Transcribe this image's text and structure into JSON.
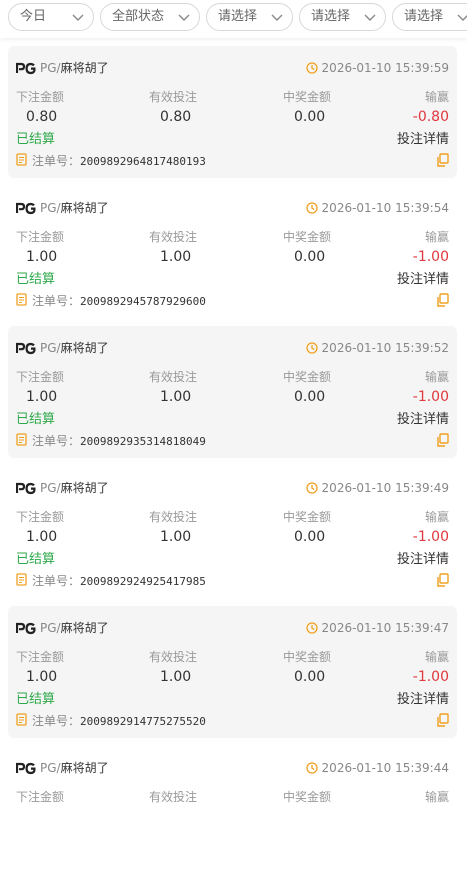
{
  "filters": [
    {
      "label": "今日"
    },
    {
      "label": "全部状态"
    },
    {
      "label": "请选择"
    },
    {
      "label": "请选择"
    },
    {
      "label": "请选择"
    }
  ],
  "columns": {
    "bet": "下注金额",
    "valid": "有效投注",
    "win": "中奖金额",
    "pnl": "输赢"
  },
  "labels": {
    "settled": "已结算",
    "detail": "投注详情",
    "order_prefix": "注单号："
  },
  "colors": {
    "accent": "#f0a020",
    "settled": "#2ea84a",
    "loss": "#e0383e"
  },
  "records": [
    {
      "provider": "PG/",
      "game": "麻将胡了",
      "time": "2026-01-10 15:39:59",
      "bet": "0.80",
      "valid": "0.80",
      "win": "0.00",
      "pnl": "-0.80",
      "status": "已结算",
      "order": "2009892964817480193"
    },
    {
      "provider": "PG/",
      "game": "麻将胡了",
      "time": "2026-01-10 15:39:54",
      "bet": "1.00",
      "valid": "1.00",
      "win": "0.00",
      "pnl": "-1.00",
      "status": "已结算",
      "order": "2009892945787929600"
    },
    {
      "provider": "PG/",
      "game": "麻将胡了",
      "time": "2026-01-10 15:39:52",
      "bet": "1.00",
      "valid": "1.00",
      "win": "0.00",
      "pnl": "-1.00",
      "status": "已结算",
      "order": "2009892935314818049"
    },
    {
      "provider": "PG/",
      "game": "麻将胡了",
      "time": "2026-01-10 15:39:49",
      "bet": "1.00",
      "valid": "1.00",
      "win": "0.00",
      "pnl": "-1.00",
      "status": "已结算",
      "order": "2009892924925417985"
    },
    {
      "provider": "PG/",
      "game": "麻将胡了",
      "time": "2026-01-10 15:39:47",
      "bet": "1.00",
      "valid": "1.00",
      "win": "0.00",
      "pnl": "-1.00",
      "status": "已结算",
      "order": "2009892914775275520"
    },
    {
      "provider": "PG/",
      "game": "麻将胡了",
      "time": "2026-01-10 15:39:44"
    }
  ]
}
